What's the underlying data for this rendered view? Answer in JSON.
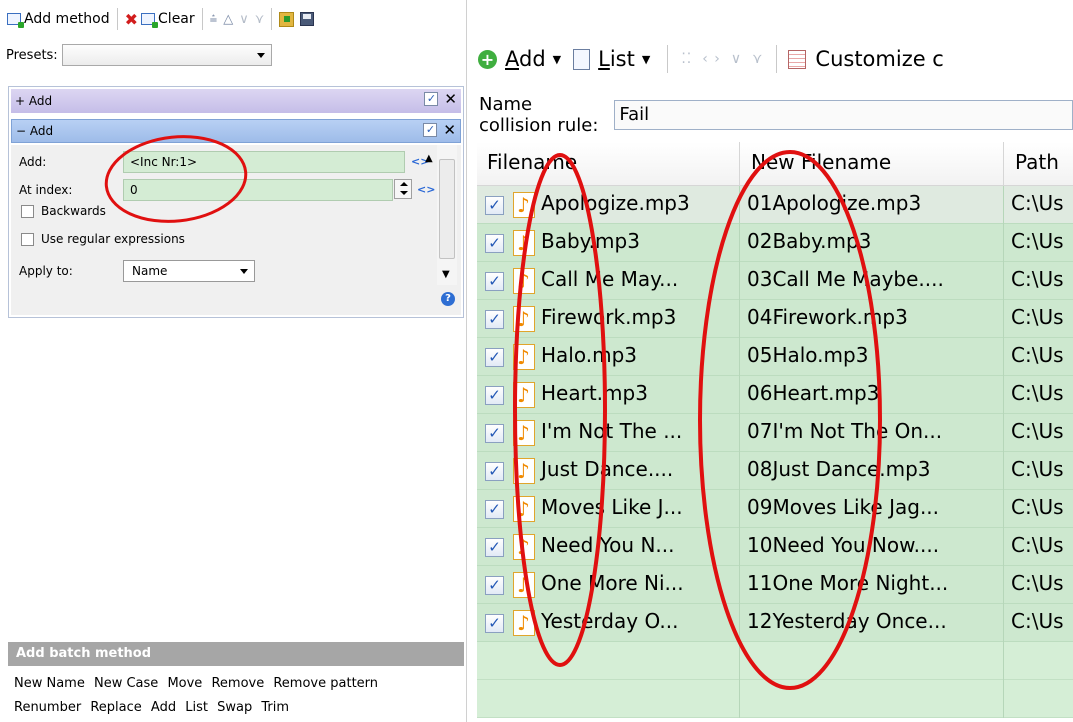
{
  "left_toolbar": {
    "add_method": "Add method",
    "clear": "Clear"
  },
  "presets": {
    "label": "Presets:",
    "value": ""
  },
  "methods": [
    {
      "toggle": "+",
      "title": "Add",
      "checked": true
    },
    {
      "toggle": "−",
      "title": "Add",
      "checked": true,
      "expanded": true
    }
  ],
  "method_form": {
    "add_label": "Add:",
    "add_value": "<Inc Nr:1>",
    "at_index_label": "At index:",
    "at_index_value": "0",
    "backwards_label": "Backwards",
    "regex_label": "Use regular expressions",
    "apply_to_label": "Apply to:",
    "apply_to_value": "Name"
  },
  "batch": {
    "header": "Add batch method",
    "links_line1": [
      "New Name",
      "New Case",
      "Move",
      "Remove",
      "Remove pattern"
    ],
    "links_line2": [
      "Renumber",
      "Replace",
      "Add",
      "List",
      "Swap",
      "Trim"
    ]
  },
  "right_toolbar": {
    "add_label": "Add",
    "add_underline": "A",
    "add_rest": "dd",
    "list_underline": "L",
    "list_rest": "ist",
    "customize_label": "Customize c"
  },
  "collision": {
    "label": "Name collision rule:",
    "value": "Fail"
  },
  "table": {
    "columns": [
      "Filename",
      "New Filename",
      "Path"
    ],
    "rows": [
      {
        "filename": "Apologize.mp3",
        "new_filename": "01Apologize.mp3",
        "path": "C:\\Us",
        "checked": true
      },
      {
        "filename": "Baby.mp3",
        "new_filename": "02Baby.mp3",
        "path": "C:\\Us",
        "checked": true
      },
      {
        "filename": "Call Me May...",
        "new_filename": "03Call Me Maybe....",
        "path": "C:\\Us",
        "checked": true
      },
      {
        "filename": "Firework.mp3",
        "new_filename": "04Firework.mp3",
        "path": "C:\\Us",
        "checked": true
      },
      {
        "filename": "Halo.mp3",
        "new_filename": "05Halo.mp3",
        "path": "C:\\Us",
        "checked": true
      },
      {
        "filename": "Heart.mp3",
        "new_filename": "06Heart.mp3",
        "path": "C:\\Us",
        "checked": true
      },
      {
        "filename": "I'm Not The ...",
        "new_filename": "07I'm Not The On...",
        "path": "C:\\Us",
        "checked": true
      },
      {
        "filename": "Just Dance....",
        "new_filename": "08Just Dance.mp3",
        "path": "C:\\Us",
        "checked": true
      },
      {
        "filename": "Moves Like J...",
        "new_filename": "09Moves Like Jag...",
        "path": "C:\\Us",
        "checked": true
      },
      {
        "filename": "Need You N...",
        "new_filename": "10Need You Now....",
        "path": "C:\\Us",
        "checked": true
      },
      {
        "filename": "One More Ni...",
        "new_filename": "11One More Night...",
        "path": "C:\\Us",
        "checked": true
      },
      {
        "filename": "Yesterday O...",
        "new_filename": "12Yesterday Once...",
        "path": "C:\\Us",
        "checked": true
      }
    ],
    "empty_rows": 2
  },
  "colors": {
    "row_green": "#cde8cf",
    "method_header_blue": "#9ebce9",
    "annotation_red": "#e01010"
  }
}
